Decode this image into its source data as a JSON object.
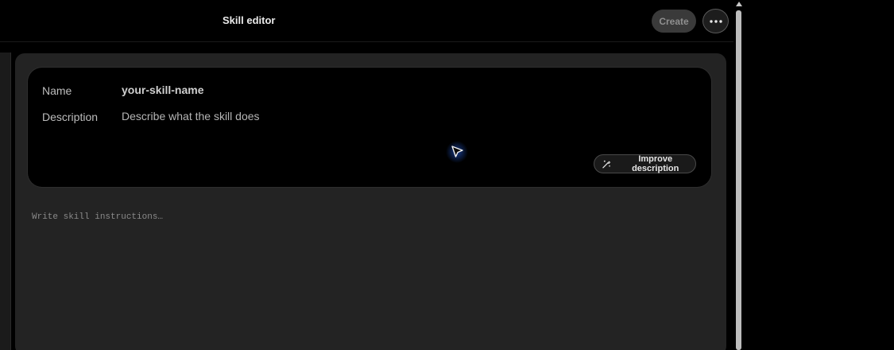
{
  "header": {
    "title": "Skill editor",
    "create_label": "Create",
    "more_icon": "more-horizontal-icon"
  },
  "skill": {
    "name_label": "Name",
    "name_value": "your-skill-name",
    "description_label": "Description",
    "description_placeholder": "Describe what the skill does",
    "improve_label": "Improve description",
    "improve_icon": "magic-wand-icon"
  },
  "instructions": {
    "placeholder": "Write skill instructions…"
  },
  "colors": {
    "background": "#000000",
    "panel": "#232323",
    "card": "#000000",
    "cursor_glow": "#2a6cff"
  }
}
